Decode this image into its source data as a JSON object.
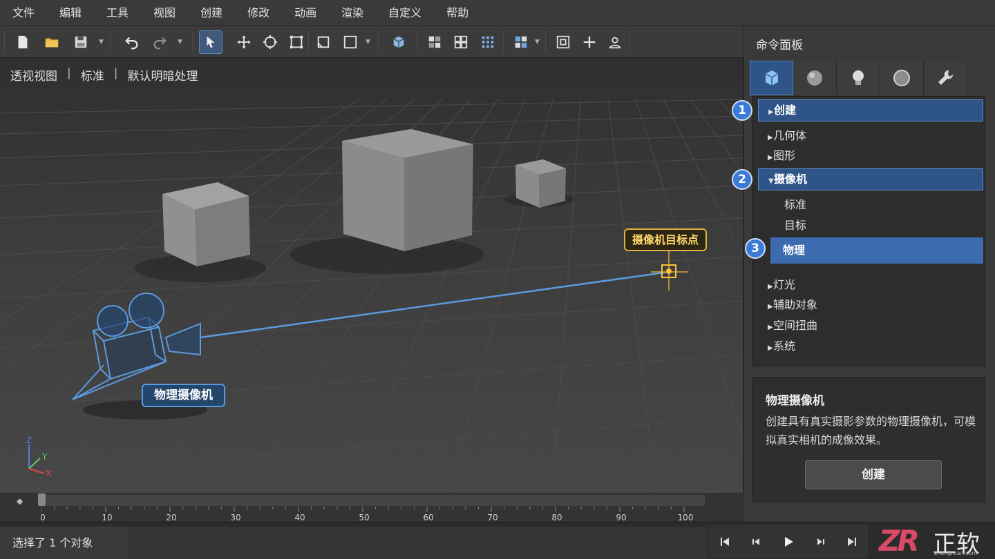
{
  "menu": [
    "文件",
    "编辑",
    "工具",
    "视图",
    "创建",
    "修改",
    "动画",
    "渲染",
    "自定义",
    "帮助"
  ],
  "toolbar": {
    "icons": [
      "new-file-icon",
      "open-folder-icon",
      "save-icon",
      "undo-icon",
      "redo-icon",
      "select-icon",
      "move-icon",
      "rotate-icon",
      "scale-icon",
      "crop-icon",
      "rect-select-icon",
      "cube-view-icon",
      "grid-a-icon",
      "grid-b-icon",
      "grid-c-icon",
      "layout-icon",
      "frame-icon",
      "plus-icon",
      "user-pin-icon"
    ],
    "active": "select-icon"
  },
  "viewport": {
    "label_view": "透视视图",
    "label_mode": "标准",
    "label_shading": "默认明暗处理",
    "separator": "|",
    "camera_callout": "物理摄像机",
    "target_callout": "摄像机目标点",
    "axes": {
      "x": "X",
      "y": "Y",
      "z": "Z"
    }
  },
  "panel": {
    "title": "命令面板",
    "tabs": [
      "create-cube-icon",
      "sphere-icon",
      "light-bulb-icon",
      "circle-icon",
      "wrench-icon"
    ],
    "tree": {
      "create": "创建",
      "geometry": "几何体",
      "shapes": "图形",
      "cameras": "摄像机",
      "standard": "标准",
      "target": "目标",
      "physical": "物理",
      "lights": "灯光",
      "helpers": "辅助对象",
      "space_warps": "空间扭曲",
      "systems": "系统"
    },
    "badges": [
      "1",
      "2",
      "3"
    ],
    "info": {
      "title": "物理摄像机",
      "description": "创建具有真实摄影参数的物理摄像机，可模拟真实相机的成像效果。",
      "button": "创建"
    }
  },
  "timeline": {
    "ticks": [
      "0",
      "10",
      "20",
      "30",
      "40",
      "50",
      "60",
      "70",
      "80",
      "90",
      "100"
    ],
    "current_frame": 0
  },
  "status": {
    "text": "选择了 1 个对象"
  },
  "logo": {
    "mark": "ZR",
    "name": "正软",
    "url": "zhengruan.com"
  },
  "colors": {
    "accent": "#2f5487",
    "camera_blue": "#5b9be0",
    "target_yellow": "#e0b440"
  }
}
